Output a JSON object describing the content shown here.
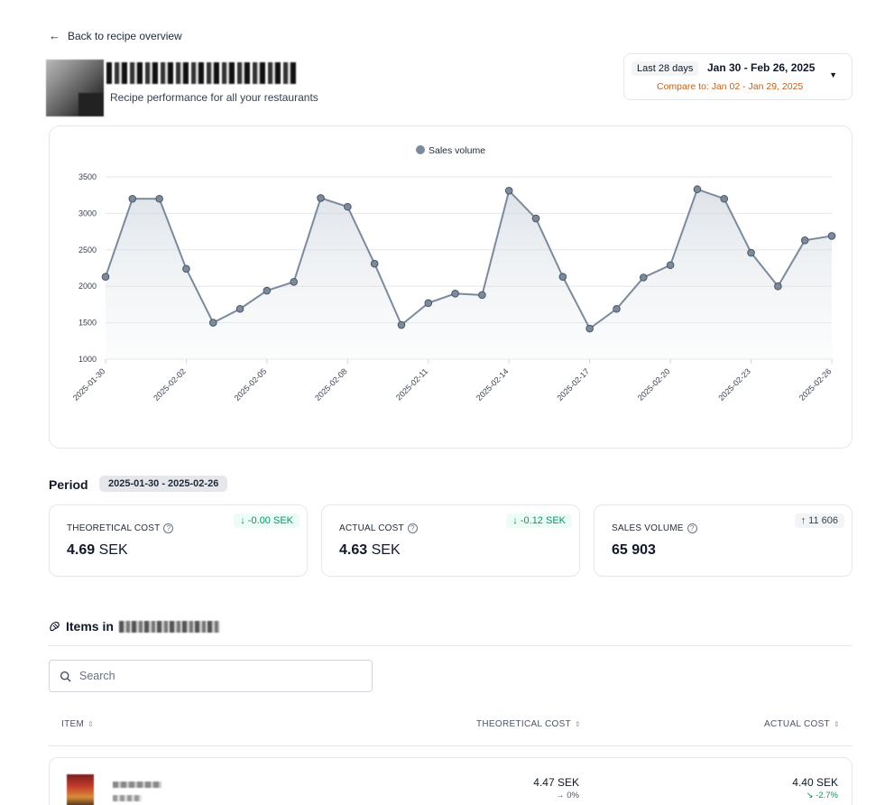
{
  "nav": {
    "back_label": "Back to recipe overview"
  },
  "header": {
    "title_redacted": "Pommes frites",
    "subtitle": "Recipe performance for all your restaurants"
  },
  "date_filter": {
    "preset": "Last 28 days",
    "range": "Jan 30 - Feb 26, 2025",
    "compare": "Compare to: Jan 02 - Jan 29, 2025"
  },
  "chart_data": {
    "type": "area",
    "legend": [
      "Sales volume"
    ],
    "legend_position": "top-center",
    "grid": true,
    "ylim": [
      1000,
      3500
    ],
    "yticks": [
      1000,
      1500,
      2000,
      2500,
      3000,
      3500
    ],
    "x_tick_labels": [
      "2025-01-30",
      "2025-02-02",
      "2025-02-05",
      "2025-02-08",
      "2025-02-11",
      "2025-02-14",
      "2025-02-17",
      "2025-02-20",
      "2025-02-23",
      "2025-02-26"
    ],
    "x": [
      "2025-01-30",
      "2025-01-31",
      "2025-02-01",
      "2025-02-02",
      "2025-02-03",
      "2025-02-04",
      "2025-02-05",
      "2025-02-06",
      "2025-02-07",
      "2025-02-08",
      "2025-02-09",
      "2025-02-10",
      "2025-02-11",
      "2025-02-12",
      "2025-02-13",
      "2025-02-14",
      "2025-02-15",
      "2025-02-16",
      "2025-02-17",
      "2025-02-18",
      "2025-02-19",
      "2025-02-20",
      "2025-02-21",
      "2025-02-22",
      "2025-02-23",
      "2025-02-24",
      "2025-02-25",
      "2025-02-26"
    ],
    "series": [
      {
        "name": "Sales volume",
        "color": "#7b8a9c",
        "values": [
          2130,
          3200,
          3200,
          2240,
          1500,
          1690,
          1940,
          2060,
          3210,
          3090,
          2310,
          1470,
          1770,
          1900,
          1880,
          3310,
          2930,
          2130,
          1420,
          1690,
          2120,
          2290,
          3330,
          3200,
          2460,
          2000,
          2630,
          2690
        ]
      }
    ]
  },
  "period": {
    "label": "Period",
    "range": "2025-01-30 - 2025-02-26"
  },
  "kpis": [
    {
      "label": "THEORETICAL COST",
      "value": "4.69",
      "unit": "SEK",
      "delta": "↓ -0.00 SEK"
    },
    {
      "label": "ACTUAL COST",
      "value": "4.63",
      "unit": "SEK",
      "delta": "↓ -0.12 SEK"
    },
    {
      "label": "SALES VOLUME",
      "value": "65 903",
      "unit": "",
      "delta": "↑ 11 606"
    }
  ],
  "items": {
    "heading_prefix": "Items in",
    "heading_redacted": "Pommes frites",
    "search_placeholder": "Search",
    "columns": [
      "ITEM",
      "THEORETICAL COST",
      "ACTUAL COST"
    ],
    "rows": [
      {
        "theoretical": "4.47 SEK",
        "theoretical_change": "→ 0%",
        "actual": "4.40 SEK",
        "actual_change": "↘ -2.7%"
      }
    ]
  },
  "colors": {
    "accent_green": "#059669",
    "compare_orange": "#c2621a",
    "series": "#7b8a9c"
  }
}
